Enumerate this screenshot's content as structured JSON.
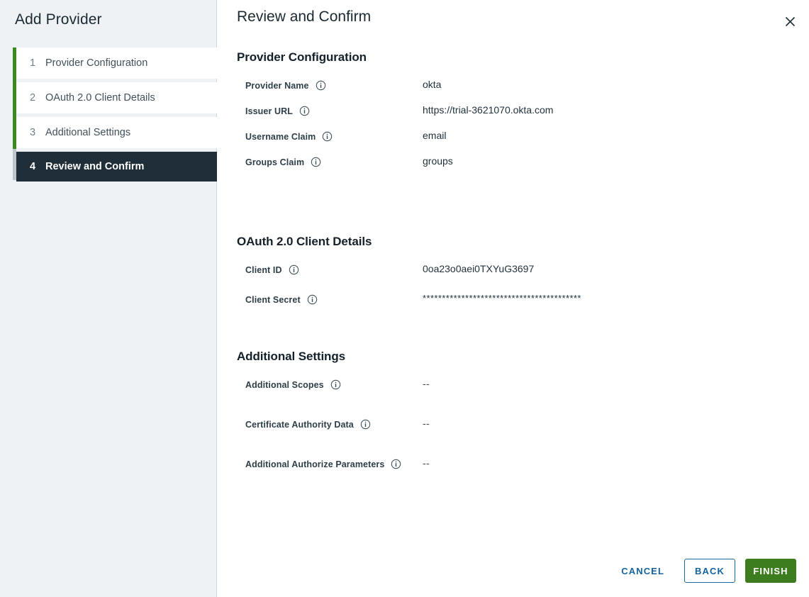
{
  "sidebar": {
    "title": "Add Provider",
    "steps": [
      {
        "num": "1",
        "label": "Provider Configuration",
        "active": false
      },
      {
        "num": "2",
        "label": "OAuth 2.0 Client Details",
        "active": false
      },
      {
        "num": "3",
        "label": "Additional Settings",
        "active": false
      },
      {
        "num": "4",
        "label": "Review and Confirm",
        "active": true
      }
    ]
  },
  "main": {
    "page_title": "Review and Confirm",
    "close_icon": "close-icon",
    "sections": [
      {
        "heading": "Provider Configuration",
        "rows": [
          {
            "label": "Provider Name",
            "icon": "info-icon",
            "value": "okta"
          },
          {
            "label": "Issuer URL",
            "icon": "info-icon",
            "value": "https://trial-3621070.okta.com"
          },
          {
            "label": "Username Claim",
            "icon": "info-icon",
            "value": "email"
          },
          {
            "label": "Groups Claim",
            "icon": "info-icon",
            "value": "groups"
          }
        ]
      },
      {
        "heading": "OAuth 2.0 Client Details",
        "rows": [
          {
            "label": "Client ID",
            "icon": "info-icon",
            "value": "0oa23o0aei0TXYuG3697"
          },
          {
            "label": "Client Secret",
            "icon": "info-icon",
            "value": "*****************************************"
          }
        ]
      },
      {
        "heading": "Additional Settings",
        "rows": [
          {
            "label": "Additional Scopes",
            "icon": "info-icon",
            "value": "--"
          },
          {
            "label": "Certificate Authority Data",
            "icon": "info-icon",
            "value": "--"
          },
          {
            "label": "Additional Authorize Parameters",
            "icon": "info-icon",
            "value": "--"
          }
        ]
      }
    ]
  },
  "footer": {
    "cancel_label": "CANCEL",
    "back_label": "BACK",
    "finish_label": "FINISH"
  },
  "colors": {
    "sidebar_bg": "#eef2f5",
    "active_step_bg": "#1f2e38",
    "progress_green": "#3a8b1f",
    "link_blue": "#14639e",
    "finish_green": "#3d7d20"
  }
}
